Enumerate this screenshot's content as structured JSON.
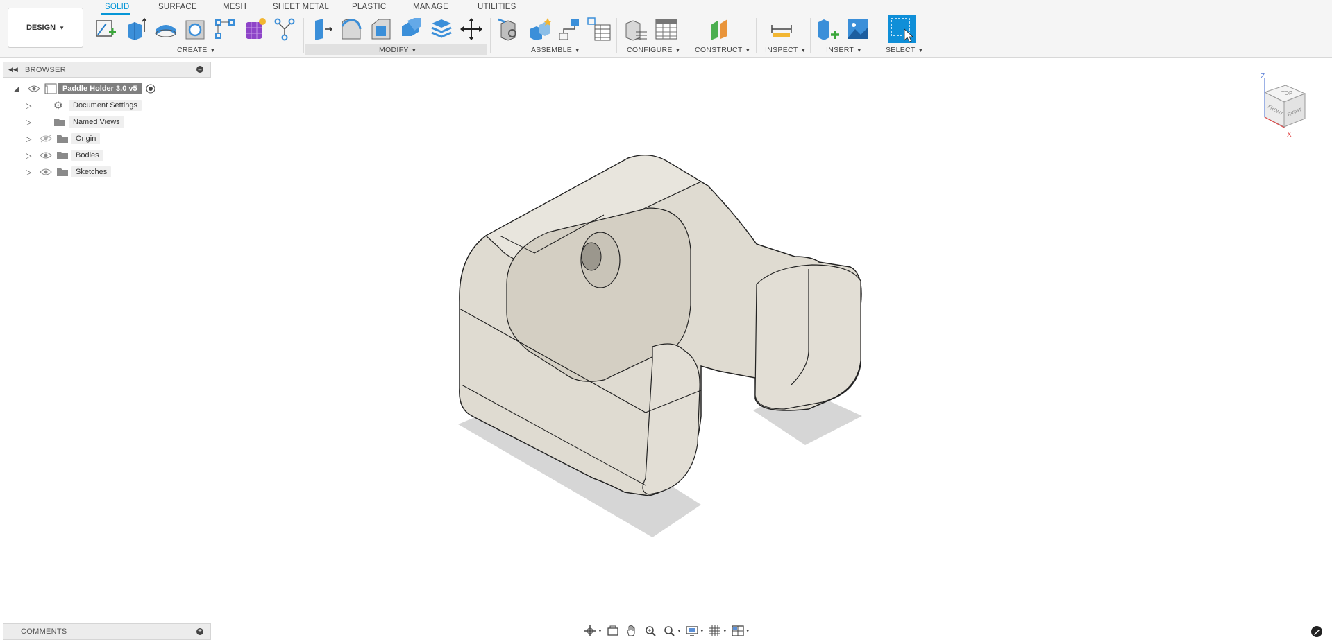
{
  "workspace": {
    "label": "DESIGN"
  },
  "tabs": [
    "SOLID",
    "SURFACE",
    "MESH",
    "SHEET METAL",
    "PLASTIC",
    "MANAGE",
    "UTILITIES"
  ],
  "groups": {
    "create": "CREATE",
    "modify": "MODIFY",
    "assemble": "ASSEMBLE",
    "configure": "CONFIGURE",
    "construct": "CONSTRUCT",
    "inspect": "INSPECT",
    "insert": "INSERT",
    "select": "SELECT"
  },
  "browser": {
    "title": "BROWSER",
    "root": "Paddle Holder 3.0 v5",
    "items": [
      "Document Settings",
      "Named Views",
      "Origin",
      "Bodies",
      "Sketches"
    ]
  },
  "comments": {
    "title": "COMMENTS"
  },
  "viewcube": {
    "top": "TOP",
    "front": "FRONT",
    "right": "RIGHT",
    "z": "Z",
    "x": "X"
  },
  "colors": {
    "accent": "#0696d7",
    "body": "#dcd8cf",
    "shadow": "#cfcfcf"
  }
}
